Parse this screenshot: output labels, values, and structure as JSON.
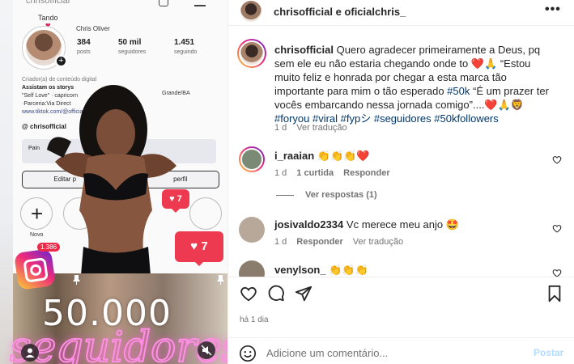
{
  "media": {
    "phone_title": "chrisofficial",
    "tando": "Tando",
    "profile_name": "Chris Oliver",
    "stats": [
      {
        "value": "384",
        "label": "posts"
      },
      {
        "value": "50 mil",
        "label": "seguidores"
      },
      {
        "value": "1.451",
        "label": "seguindo"
      }
    ],
    "bio_category": "Criador(a) de conteúdo digital",
    "bio_lines": [
      "Assistam os storys",
      "\"Self Love\" · capricorn",
      "·Parceria:Via Direct",
      "www.tiktok.com/@officialchris_"
    ],
    "bio_right": "Grande/BA",
    "threads_handle": "chrisofficial",
    "panel_label": "Pain",
    "edit_button": "Editar p",
    "edit_button_right": "perfil",
    "highlight_new": "Novo",
    "follower_badge": "1.386",
    "like_counts": [
      "7",
      "7"
    ],
    "overlay_number": "50.000",
    "overlay_word": "seguidores"
  },
  "header": {
    "username": "chrisofficial e oficialchris_",
    "more_icon": "more-horizontal-icon"
  },
  "caption": {
    "username": "chrisofficial",
    "text": "Quero agradecer primeiramente a Deus, pq sem ele eu não estaria chegando onde to ❤️🙏 “Estou muito feliz e honrada por chegar a esta marca tão importante para mim o tão esperado ",
    "hashtag_inline": "#50k",
    "text2": " “É um prazer ter vocês embarcando nessa jornada comigo”....❤️🙏🦁 ",
    "hashtags": "#foryou #viral #fypシ #seguidores #50kfollowers",
    "time": "1 d",
    "translate": "Ver tradução"
  },
  "comments": [
    {
      "username": "i_raaian",
      "text": "👏👏👏❤️",
      "time": "1 d",
      "likes": "1 curtida",
      "reply": "Responder"
    },
    {
      "username": "josivaldo2334",
      "text": "Vc merece meu anjo 🤩",
      "time": "1 d",
      "reply": "Responder",
      "translate": "Ver tradução"
    },
    {
      "username": "venylson_",
      "text": "👏👏👏"
    }
  ],
  "view_replies": "Ver respostas (1)",
  "time_ago": "há 1 dia",
  "add_comment": {
    "placeholder": "Adicione um comentário...",
    "post": "Postar"
  },
  "colors": {
    "accent": "#0095f6",
    "hashtag": "#00376b",
    "heart": "#ed4956",
    "post_disabled": "#b3dbff"
  }
}
